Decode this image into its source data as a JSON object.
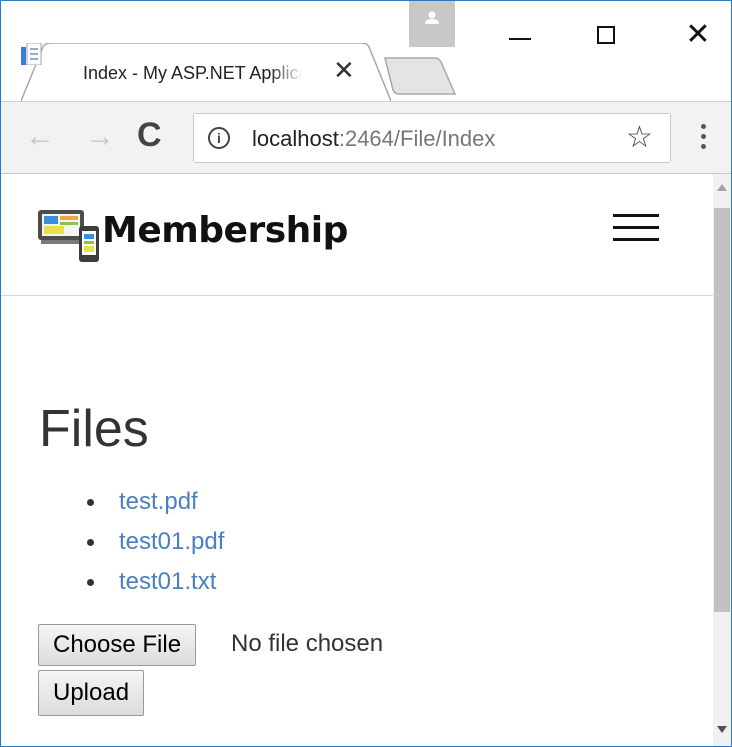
{
  "browser": {
    "tab": {
      "title": "Index - My ASP.NET Application",
      "close": "✕"
    },
    "window_close": "✕",
    "nav": {
      "back": "←",
      "forward": "→",
      "reload": "C"
    },
    "address": {
      "host": "localhost",
      "path": ":2464/File/Index",
      "info": "i"
    },
    "bookmark_icon": "☆"
  },
  "page": {
    "brand": "Membership",
    "heading": "Files",
    "files": [
      "test.pdf",
      "test01.pdf",
      "test01.txt"
    ],
    "choose_button": "Choose File",
    "no_file_text": "No file chosen",
    "upload_button": "Upload"
  },
  "colors": {
    "link": "#4a7fc1",
    "window_border": "#2b78c5",
    "toolbar_bg": "#f2f2f2"
  }
}
